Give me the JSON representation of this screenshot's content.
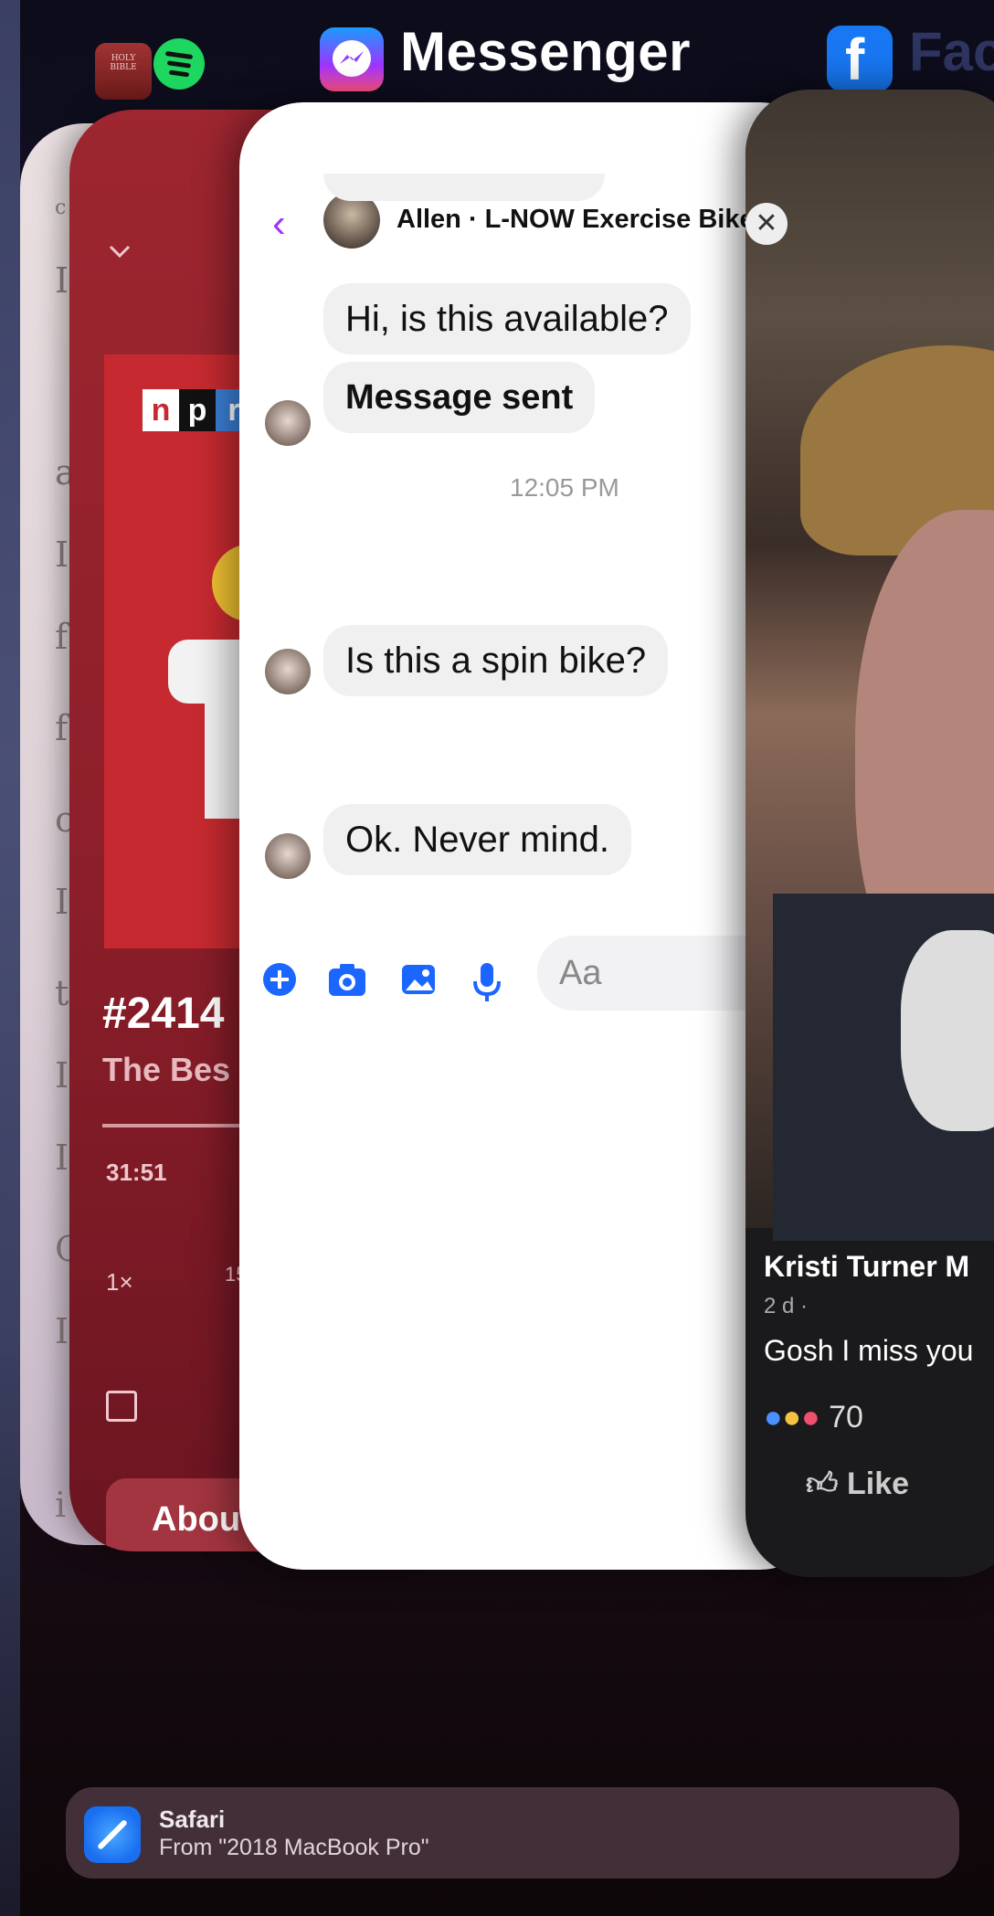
{
  "switcher": {
    "active_app_name": "Messenger",
    "next_app_name": "Face",
    "app_icons": [
      "bible-icon",
      "spotify-icon",
      "messenger-icon",
      "facebook-icon"
    ]
  },
  "books_card": {
    "letters": [
      "c",
      "I",
      "a",
      "I",
      "f",
      "f",
      "c",
      "I",
      "t",
      "I",
      "I",
      "C",
      "I",
      "i"
    ]
  },
  "podcast_card": {
    "logo": [
      "n",
      "p",
      "r"
    ],
    "episode_title": "#2414",
    "show_name": "The Bes",
    "elapsed_time": "31:51",
    "speed": "1×",
    "skip_label": "15",
    "about_label": "About t"
  },
  "messenger_card": {
    "contact_name": "Allen · L-NOW Exercise Bike",
    "messages": [
      {
        "text": "Hi, is this available?",
        "bold": false
      },
      {
        "text": "Message sent",
        "bold": true
      },
      {
        "text": "Is this a spin bike?",
        "bold": false
      },
      {
        "text": "Ok.  Never mind.",
        "bold": false
      }
    ],
    "timestamp": "12:05 PM",
    "input_placeholder": "Aa",
    "toolbar_icons": [
      "plus-icon",
      "camera-icon",
      "gallery-icon",
      "microphone-icon"
    ]
  },
  "facebook_card": {
    "poster_name": "Kristi Turner M",
    "meta": "2 d · ",
    "caption": "Gosh I miss you",
    "reaction_count": "70",
    "like_label": "Like"
  },
  "handoff": {
    "app": "Safari",
    "source": "From \"2018 MacBook Pro\""
  }
}
